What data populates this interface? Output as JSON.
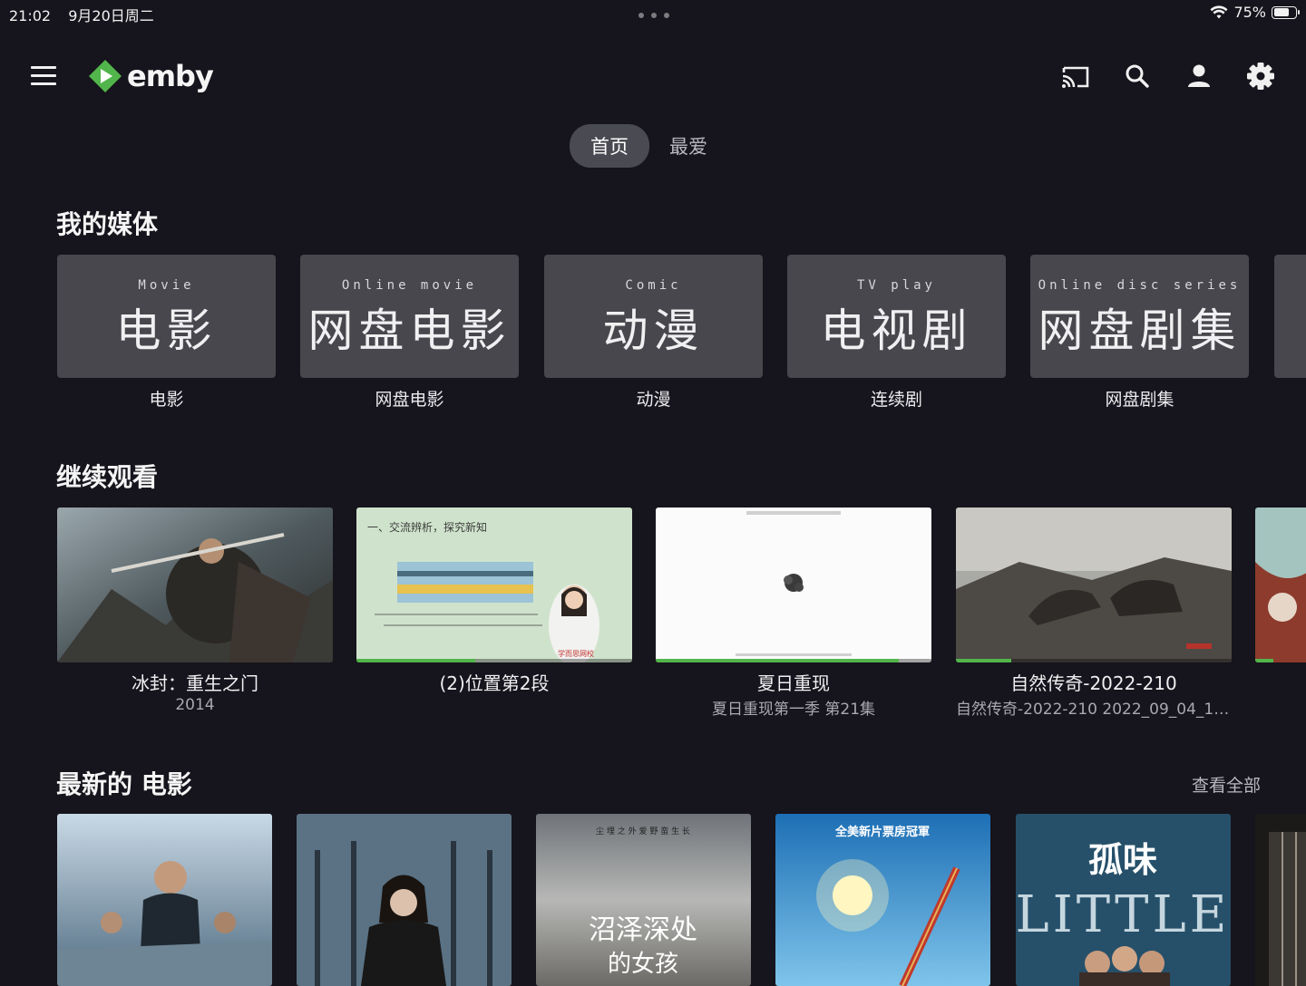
{
  "status_bar": {
    "time": "21:02",
    "date": "9月20日周二",
    "battery_text": "75%",
    "battery_level": 0.75
  },
  "header": {
    "logo_text": "emby"
  },
  "tabs": [
    {
      "label": "首页",
      "active": true
    },
    {
      "label": "最爱",
      "active": false
    }
  ],
  "my_media": {
    "title": "我的媒体",
    "libraries": [
      {
        "en": "Movie",
        "cn": "电影",
        "label": "电影"
      },
      {
        "en": "Online movie",
        "cn": "网盘电影",
        "label": "网盘电影"
      },
      {
        "en": "Comic",
        "cn": "动漫",
        "label": "动漫"
      },
      {
        "en": "TV play",
        "cn": "电视剧",
        "label": "连续剧"
      },
      {
        "en": "Online disc series",
        "cn": "网盘剧集",
        "label": "网盘剧集"
      }
    ]
  },
  "continue_watching": {
    "title": "继续观看",
    "items": [
      {
        "title": "冰封：重生之门",
        "subtitle": "2014",
        "progress": 0.0
      },
      {
        "title": "(2)位置第2段",
        "subtitle": "",
        "progress": 0.43
      },
      {
        "title": "夏日重现",
        "subtitle": "夏日重现第一季 第21集",
        "progress": 0.88
      },
      {
        "title": "自然传奇-2022-210",
        "subtitle": "自然传奇-2022-210 2022_09_04_10...",
        "progress": 0.2
      }
    ],
    "thumb_text": {
      "lesson_heading": "一、交流辨析，探究新知",
      "lesson_watermark": "学而思网校"
    }
  },
  "latest_movies": {
    "title": "最新的 电影",
    "view_all": "查看全部",
    "poster_text": {
      "p3_top": "尘 埋 之 外    爱 野 蛮 生 长",
      "p3_title": "沼泽深处",
      "p3_title2": "的女孩",
      "p4_top": "全美新片票房冠軍",
      "p5_cn": "孤味",
      "p5_en": "LITTLE"
    }
  },
  "colors": {
    "accent": "#52b54b",
    "background": "#16141c",
    "tile": "#48474d"
  },
  "icons": [
    "menu-icon",
    "emby-logo-icon",
    "cast-icon",
    "search-icon",
    "user-icon",
    "settings-icon",
    "wifi-icon",
    "battery-icon"
  ]
}
